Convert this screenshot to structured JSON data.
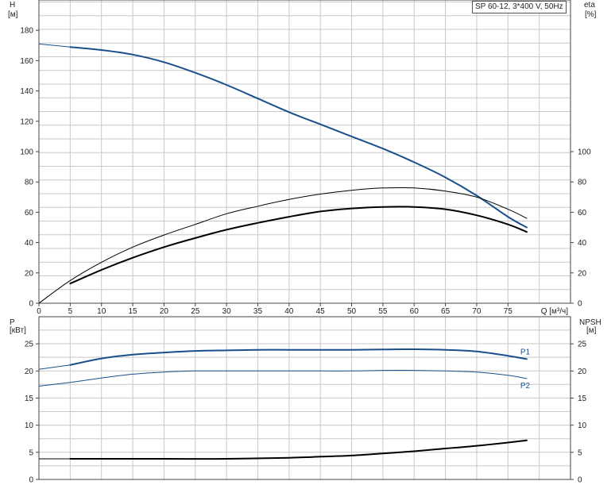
{
  "model_label": "SP 60-12, 3*400 V, 50Hz",
  "colors": {
    "grid": "#c8c8c8",
    "frame": "#444444",
    "pump_blue": "#1b4f8c",
    "efficiency_black": "#000000",
    "background": "#ffffff"
  },
  "chart_data": [
    {
      "type": "line",
      "title": "",
      "left_axis": {
        "label_line1": "H",
        "label_line2": "[м]",
        "ylim": [
          0,
          200
        ],
        "ticks": [
          0,
          20,
          40,
          60,
          80,
          100,
          120,
          140,
          160,
          180
        ]
      },
      "right_axis": {
        "label_line1": "eta",
        "label_line2": "[%]",
        "ylim": [
          0,
          200
        ],
        "ticks": [
          0,
          20,
          40,
          60,
          80,
          100
        ]
      },
      "x_axis": {
        "label": "Q [м³/ч]",
        "xlim": [
          0,
          85
        ],
        "ticks": [
          0,
          5,
          10,
          15,
          20,
          25,
          30,
          35,
          40,
          45,
          50,
          55,
          60,
          65,
          70,
          75
        ]
      },
      "grid": true,
      "series": [
        {
          "key": "head",
          "axis": "left",
          "color": "#1b4f8c",
          "width": 2,
          "dashed_prefix_to_x": 5,
          "x": [
            0,
            5,
            10,
            15,
            20,
            25,
            30,
            35,
            40,
            45,
            50,
            55,
            60,
            65,
            70,
            75,
            78
          ],
          "y": [
            171,
            169,
            167,
            164,
            159,
            152,
            144,
            135,
            126,
            118,
            110,
            102,
            93,
            83,
            71,
            57,
            50
          ]
        },
        {
          "key": "eta_thin",
          "axis": "right",
          "color": "#000000",
          "width": 1,
          "x": [
            0,
            5,
            10,
            15,
            20,
            25,
            30,
            35,
            40,
            45,
            50,
            55,
            60,
            65,
            70,
            75,
            78
          ],
          "y": [
            0,
            15,
            27,
            37,
            45,
            52,
            59,
            64,
            68.5,
            72,
            74.5,
            76,
            76,
            74,
            70,
            62,
            56
          ]
        },
        {
          "key": "eta_thick",
          "axis": "right",
          "color": "#000000",
          "width": 2,
          "x": [
            5,
            10,
            15,
            20,
            25,
            30,
            35,
            40,
            45,
            50,
            55,
            60,
            65,
            70,
            75,
            78
          ],
          "y": [
            13,
            22,
            30,
            37,
            43,
            48.5,
            53,
            57,
            60.5,
            62.5,
            63.5,
            63.5,
            62,
            58,
            52,
            47
          ]
        }
      ]
    },
    {
      "type": "line",
      "title": "",
      "left_axis": {
        "label_line1": "P",
        "label_line2": "[кВт]",
        "ylim": [
          0,
          30
        ],
        "ticks": [
          0,
          5,
          10,
          15,
          20,
          25
        ]
      },
      "right_axis": {
        "label_line1": "NPSH",
        "label_line2": "[м]",
        "ylim": [
          0,
          30
        ],
        "ticks": [
          0,
          5,
          10,
          15,
          20,
          25
        ]
      },
      "x_axis": {
        "xlim": [
          0,
          85
        ]
      },
      "grid": true,
      "series": [
        {
          "name": "P1",
          "key": "p1",
          "axis": "left",
          "color": "#1b4f8c",
          "width": 2,
          "dashed_prefix_to_x": 5,
          "x": [
            0,
            5,
            10,
            15,
            20,
            25,
            30,
            35,
            40,
            45,
            50,
            55,
            60,
            65,
            70,
            75,
            78
          ],
          "y": [
            20.3,
            21.1,
            22.3,
            23.0,
            23.4,
            23.7,
            23.8,
            23.9,
            23.9,
            23.9,
            23.9,
            23.95,
            24.0,
            23.9,
            23.6,
            22.8,
            22.2
          ]
        },
        {
          "name": "P2",
          "key": "p2",
          "axis": "left",
          "color": "#1b4f8c",
          "width": 1,
          "x": [
            0,
            5,
            10,
            15,
            20,
            25,
            30,
            35,
            40,
            45,
            50,
            55,
            60,
            65,
            70,
            75,
            78
          ],
          "y": [
            17.2,
            17.9,
            18.7,
            19.4,
            19.8,
            20.0,
            20.0,
            20.0,
            20.0,
            20.0,
            20.0,
            20.1,
            20.1,
            20.0,
            19.8,
            19.2,
            18.6
          ]
        },
        {
          "key": "npsh",
          "axis": "right",
          "color": "#000000",
          "width": 2,
          "dashed_prefix_to_x": 5,
          "x": [
            0,
            5,
            10,
            20,
            30,
            40,
            45,
            50,
            55,
            60,
            65,
            70,
            75,
            78
          ],
          "y": [
            3.8,
            3.8,
            3.8,
            3.8,
            3.8,
            4.0,
            4.2,
            4.4,
            4.8,
            5.2,
            5.7,
            6.2,
            6.8,
            7.2
          ]
        }
      ]
    }
  ]
}
